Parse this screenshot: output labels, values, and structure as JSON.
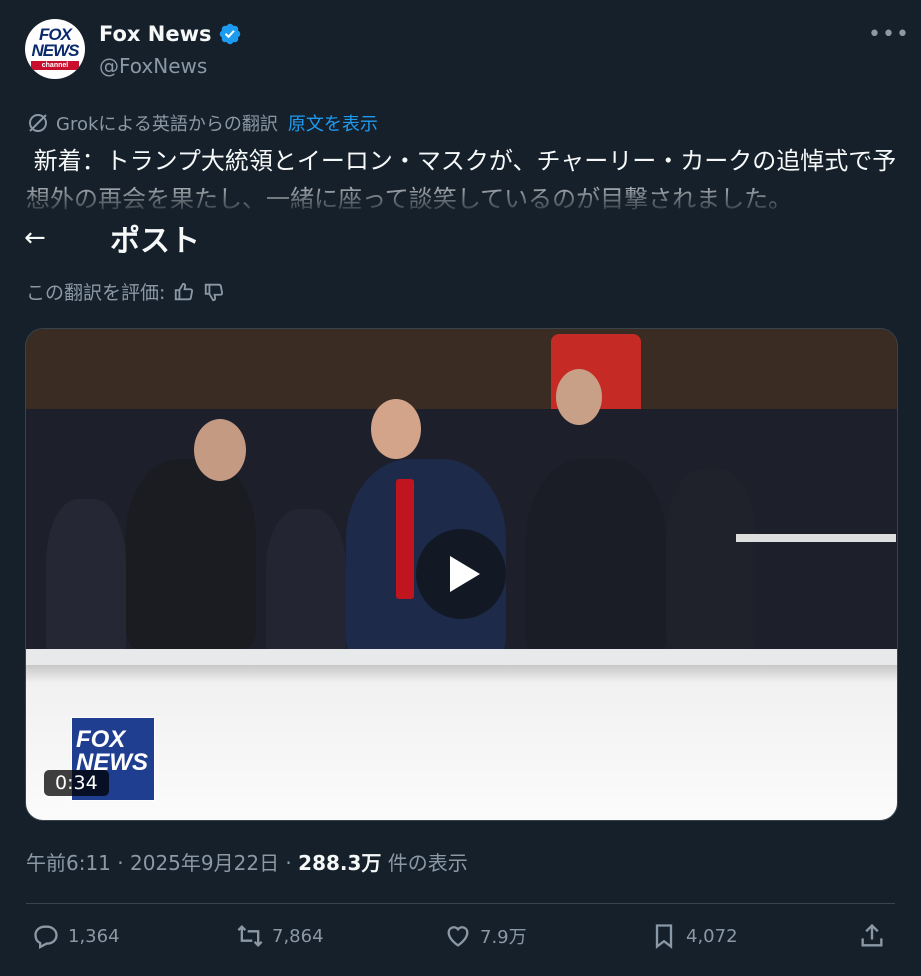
{
  "account": {
    "name": "Fox News",
    "handle": "@FoxNews",
    "avatar_text": "FOX NEWS",
    "avatar_sub": "channel"
  },
  "translation": {
    "label": "Grokによる英語からの翻訳",
    "show_original": "原文を表示",
    "rate_label": "この翻訳を評価:"
  },
  "tweet": {
    "text": " 新着：トランプ大統領とイーロン・マスクが、チャーリー・カークの追悼式で予想外の再会を果たし、一緒に座って談笑しているのが目撃されました。"
  },
  "header": {
    "title": "ポスト"
  },
  "video": {
    "duration": "0:34",
    "bug_text": "FOX NEWS"
  },
  "meta": {
    "time": "午前6:11",
    "date": "2025年9月22日",
    "views": "288.3万",
    "views_suffix": "件の表示",
    "sep": " · "
  },
  "actions": {
    "replies": "1,364",
    "reposts": "7,864",
    "likes": "7.9万",
    "bookmarks": "4,072"
  },
  "colors": {
    "background": "#15202b",
    "accent": "#1d9bf0",
    "muted": "#8b98a5"
  }
}
